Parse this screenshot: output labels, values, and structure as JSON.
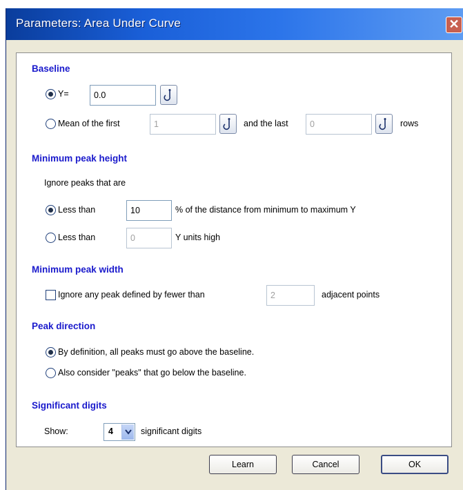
{
  "window": {
    "title": "Parameters: Area Under Curve",
    "close_glyph": "✕"
  },
  "baseline": {
    "heading": "Baseline",
    "y_label": "Y=",
    "y_value": "0.0",
    "mean_label": "Mean of the first",
    "first_value": "1",
    "and_last_label": "and the last",
    "last_value": "0",
    "rows_label": "rows",
    "selected": "y"
  },
  "min_peak_height": {
    "heading": "Minimum peak height",
    "intro": "Ignore peaks that are",
    "less_than_label": "Less than",
    "percent_value": "10",
    "percent_suffix": "% of the distance from minimum to maximum Y",
    "units_value": "0",
    "units_suffix": "Y units high",
    "selected": "percent"
  },
  "min_peak_width": {
    "heading": "Minimum peak width",
    "checkbox_label": "Ignore any peak defined by fewer than",
    "checked": false,
    "points_value": "2",
    "points_suffix": "adjacent points"
  },
  "peak_direction": {
    "heading": "Peak direction",
    "option_above": "By definition, all peaks must go above the baseline.",
    "option_below": "Also consider \"peaks\" that go below the baseline.",
    "selected": "above"
  },
  "significant_digits": {
    "heading": "Significant digits",
    "show_label": "Show:",
    "value": "4",
    "suffix": "significant digits"
  },
  "buttons": {
    "learn": "Learn",
    "cancel": "Cancel",
    "ok": "OK"
  },
  "icons": {
    "hook": "hook-icon",
    "dropdown": "chevron-down-icon"
  },
  "colors": {
    "section_heading": "#1a1acc",
    "titlebar": "#2c75ea",
    "dialog_bg": "#ece9d8"
  }
}
